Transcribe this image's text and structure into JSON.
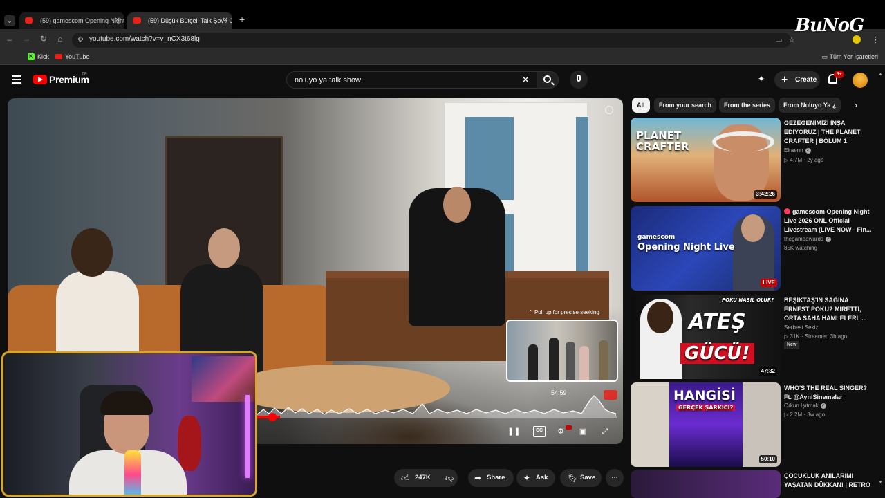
{
  "browser": {
    "tabs": [
      {
        "title": "(59) gamescom Opening Night"
      },
      {
        "title": "(59) Düşük Bütçeli Talk Şov / Gi"
      }
    ],
    "url": "youtube.com/watch?v=v_nCX3t68lg",
    "bookmarks": [
      {
        "label": "Kick"
      },
      {
        "label": "YouTube"
      }
    ],
    "bookmarks_folder": "Tüm Yer İşaretleri"
  },
  "youtube": {
    "logo": "Premium",
    "logo_superscript": "TR",
    "search_query": "noluyo ya talk show",
    "create_label": "Create",
    "notifications_badge": "9+"
  },
  "player": {
    "seek_hint": "Pull up for precise seeking",
    "preview_time": "54:59",
    "progress_fraction": 0.44
  },
  "actions": {
    "likes": "247K",
    "share": "Share",
    "ask": "Ask",
    "save": "Save"
  },
  "chips": [
    "All",
    "From your search",
    "From the series",
    "From Noluyo Ya ¿"
  ],
  "recommendations": [
    {
      "title": "GEZEGENİMİZİ İNŞA EDİYORUZ | THE PLANET CRAFTER | BÖLÜM 1",
      "channel": "Elraenn",
      "meta": "4.7M · 2y ago",
      "duration": "3:42:26",
      "thumb_text": "PLANET CRAFTER"
    },
    {
      "title": "gamescom Opening Night Live 2026 ONL Official Livestream (LIVE NOW - Fin...",
      "channel": "thegameawards",
      "meta": "85K watching",
      "duration": "LIVE",
      "thumb_text": "Opening Night Live",
      "thumb_subtext": "gamescom"
    },
    {
      "title": "BEŞİKTAŞ'IN SAĞINA ERNEST POKU? MİRETTİ, ORTA SAHA HAMLELERİ, ...",
      "channel": "Serbest Sekiz",
      "meta": "31K · Streamed 3h ago",
      "badge": "New",
      "duration": "47:32",
      "thumb_text": "ATEŞ",
      "thumb_subtext": "GÜCÜ!",
      "thumb_tag": "POKU NASIL OLUR?"
    },
    {
      "title": "WHO'S THE REAL SINGER? Ft. @AyniSinemalar",
      "channel": "Orkun Işıtmak",
      "meta": "2.2M · 3w ago",
      "duration": "50:10",
      "thumb_text": "HANGİSİ",
      "thumb_subtext": "GERÇEK ŞARKICI?"
    },
    {
      "title": "ÇOCUKLUK ANILARIMI YAŞATAN DÜKKAN! | RETRO"
    }
  ],
  "watermark": "BuNoG",
  "colors": {
    "brand_red": "#ff0000",
    "live_red": "#cc0000",
    "webcam_border": "#d7a62a",
    "background": "#0f0f0f"
  }
}
